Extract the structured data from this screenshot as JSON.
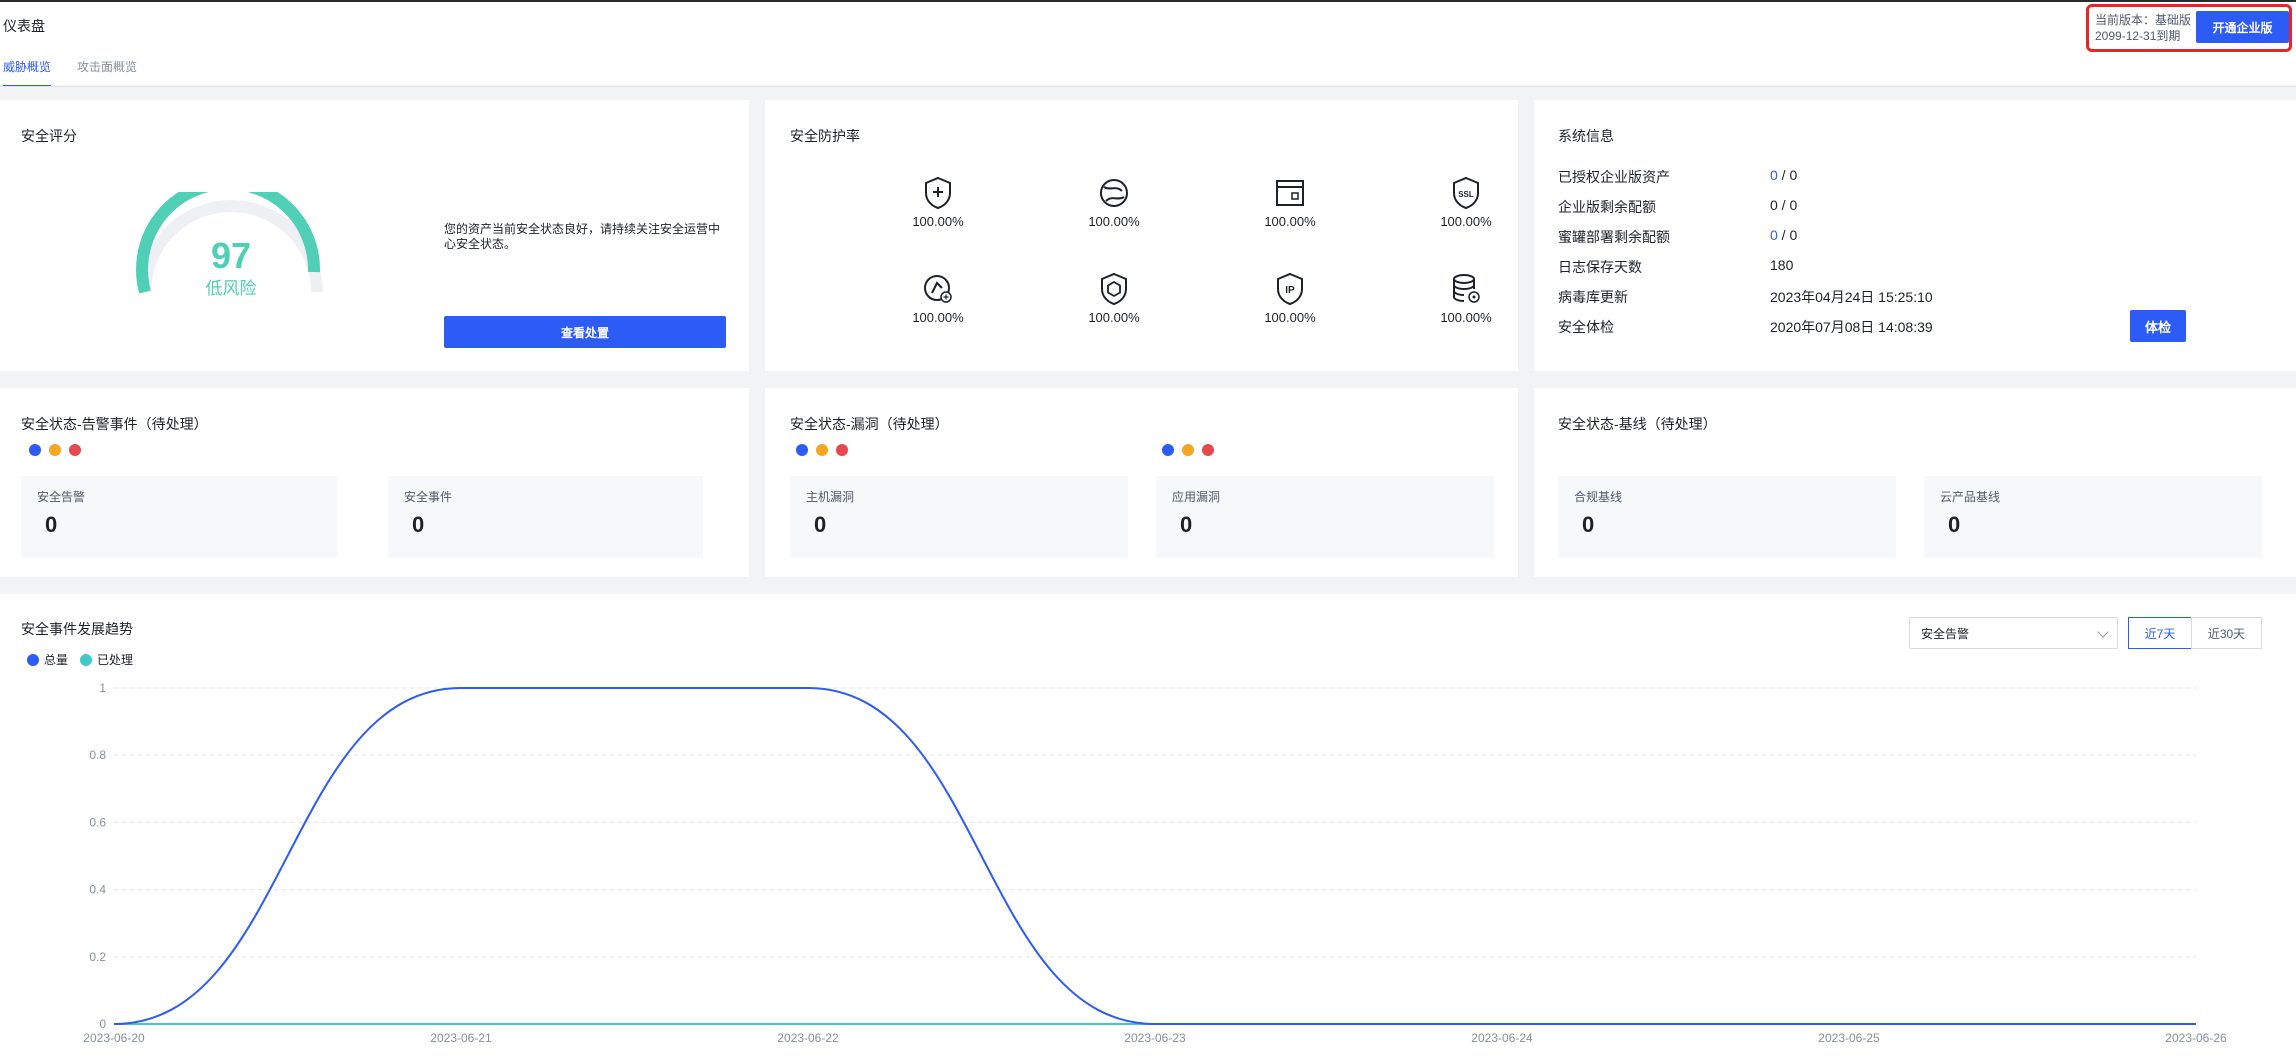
{
  "header": {
    "title": "仪表盘",
    "tabs": [
      {
        "label": "威胁概览",
        "active": true
      },
      {
        "label": "攻击面概览",
        "active": false
      }
    ],
    "version_line1": "当前版本：基础版",
    "version_line2": "2099-12-31到期",
    "upgrade_label": "开通企业版"
  },
  "score_card": {
    "title": "安全评分",
    "score": "97",
    "level": "低风险",
    "description": "您的资产当前安全状态良好，请持续关注安全运营中心安全状态。",
    "button_label": "查看处置"
  },
  "protection_card": {
    "title": "安全防护率",
    "items": [
      {
        "icon": "shield-plus-icon",
        "value": "100.00%"
      },
      {
        "icon": "globe-icon",
        "value": "100.00%"
      },
      {
        "icon": "browser-window-icon",
        "value": "100.00%"
      },
      {
        "icon": "ssl-shield-icon",
        "value": "100.00%"
      },
      {
        "icon": "compass-shield-icon",
        "value": "100.00%"
      },
      {
        "icon": "hexagon-icon",
        "value": "100.00%"
      },
      {
        "icon": "ip-shield-icon",
        "value": "100.00%"
      },
      {
        "icon": "database-settings-icon",
        "value": "100.00%"
      }
    ]
  },
  "system_card": {
    "title": "系统信息",
    "rows": [
      {
        "label": "已授权企业版资产",
        "value_a": "0",
        "value_b": " / 0"
      },
      {
        "label": "企业版剩余配额",
        "value_a": "0",
        "value_b": " / 0"
      },
      {
        "label": "蜜罐部署剩余配额",
        "value_a": "0",
        "value_b": " / 0"
      },
      {
        "label": "日志保存天数",
        "value": "180"
      },
      {
        "label": "病毒库更新",
        "value": "2023年04月24日 15:25:10"
      },
      {
        "label": "安全体检",
        "value": "2020年07月08日 14:08:39"
      }
    ],
    "check_button": "体检"
  },
  "alert_card": {
    "title": "安全状态-告警事件（待处理）",
    "stats": [
      {
        "label": "安全告警",
        "value": "0"
      },
      {
        "label": "安全事件",
        "value": "0"
      }
    ]
  },
  "vuln_card": {
    "title": "安全状态-漏洞（待处理）",
    "stats": [
      {
        "label": "主机漏洞",
        "value": "0"
      },
      {
        "label": "应用漏洞",
        "value": "0"
      }
    ]
  },
  "baseline_card": {
    "title": "安全状态-基线（待处理）",
    "stats": [
      {
        "label": "合规基线",
        "value": "0"
      },
      {
        "label": "云产品基线",
        "value": "0"
      }
    ]
  },
  "colors": {
    "accent": "#2d5bf5",
    "teal": "#4fcfb5",
    "dot_blue": "#2d5bf5",
    "dot_orange": "#f5a623",
    "dot_red": "#e5484d",
    "legend_done": "#40c9c6"
  },
  "trend": {
    "title": "安全事件发展趋势",
    "select_value": "安全告警",
    "range_options": [
      "近7天",
      "近30天"
    ],
    "active_range": "近7天"
  },
  "chart_data": {
    "type": "line",
    "title": "安全事件发展趋势",
    "x": [
      "2023-06-20",
      "2023-06-21",
      "2023-06-22",
      "2023-06-23",
      "2023-06-24",
      "2023-06-25",
      "2023-06-26"
    ],
    "series": [
      {
        "name": "总量",
        "values": [
          0,
          1,
          1,
          0,
          0,
          0,
          0
        ],
        "color": "#2d5bf5"
      },
      {
        "name": "已处理",
        "values": [
          0,
          0,
          0,
          0,
          0,
          0,
          0
        ],
        "color": "#40c9c6"
      }
    ],
    "y_ticks": [
      "0",
      "0.2",
      "0.4",
      "0.6",
      "0.8",
      "1"
    ],
    "ylim": [
      0,
      1
    ],
    "grid": true,
    "smooth": true,
    "legend_position": "top-left"
  }
}
